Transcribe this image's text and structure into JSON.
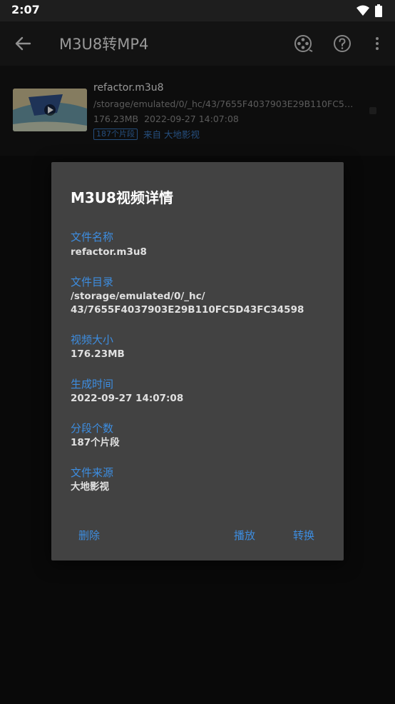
{
  "status_bar": {
    "time": "2:07",
    "icons": [
      "wifi-icon",
      "battery-icon"
    ]
  },
  "app_bar": {
    "title": "M3U8转MP4",
    "actions": [
      "film-reel-icon",
      "help-icon",
      "more-vert-icon"
    ]
  },
  "video_item": {
    "name": "refactor.m3u8",
    "path": "/storage/emulated/0/_hc/43/7655F4037903E29B110FC5D43FC34598",
    "size": "176.23MB",
    "date": "2022-09-27 14:07:08",
    "segments_badge": "187个片段",
    "source": "来自 大地影视"
  },
  "dialog": {
    "title": "M3U8视频详情",
    "fields": [
      {
        "label": "文件名称",
        "value": "refactor.m3u8"
      },
      {
        "label": "文件目录",
        "value_line1": "/storage/emulated/0/_hc/",
        "value_line2": "43/7655F4037903E29B110FC5D43FC34598"
      },
      {
        "label": "视频大小",
        "value": "176.23MB"
      },
      {
        "label": "生成时间",
        "value": "2022-09-27 14:07:08"
      },
      {
        "label": "分段个数",
        "value": "187个片段"
      },
      {
        "label": "文件来源",
        "value": "大地影视"
      }
    ],
    "buttons": {
      "delete": "删除",
      "play": "播放",
      "convert": "转换"
    }
  },
  "colors": {
    "accent": "#3d8de0",
    "dialog_bg": "#424242",
    "bar_bg": "#1e1e1e"
  }
}
